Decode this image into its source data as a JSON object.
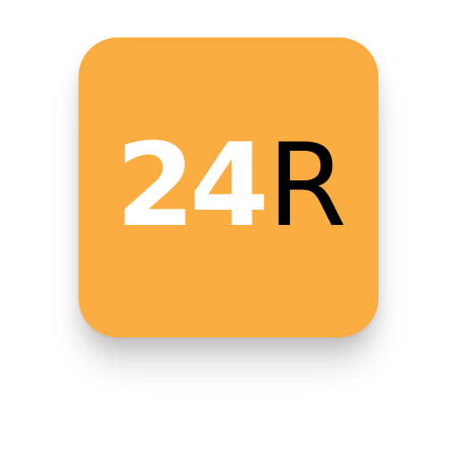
{
  "icon": {
    "background_color": "#fbad42",
    "logo": {
      "number": "24",
      "number_color": "#ffffff",
      "letter": "R",
      "letter_color": "#000000"
    }
  }
}
